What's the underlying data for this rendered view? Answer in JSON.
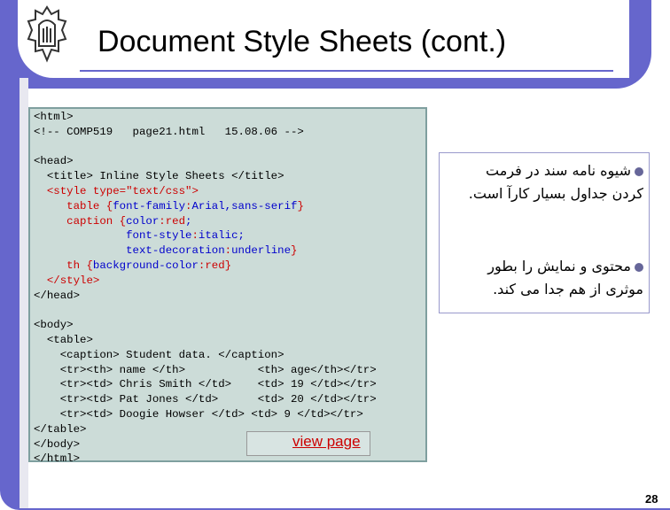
{
  "slide": {
    "title": "Document Style Sheets (cont.)",
    "page_number": "28",
    "logo_icon": "university-crest-icon",
    "colors": {
      "frame": "#6666cc",
      "code_bg": "#ccdcd8",
      "css_value": "#cc0000",
      "css_property": "#0000cc"
    }
  },
  "code": {
    "l01": "<html>",
    "l02": "<!-- COMP519   page21.html   15.08.06 -->",
    "l04": "<head>",
    "l05": "  <title> Inline Style Sheets </title>",
    "l06": "  <style type=\"text/css\">",
    "l07a": "     table {",
    "l07b": "font-family",
    "l07c": ":",
    "l07d": "Arial,sans-serif",
    "l07e": "}",
    "l08a": "     caption {",
    "l08b": "color",
    "l08c": ":",
    "l08d": "red",
    "l08e": ";",
    "l09a": "              ",
    "l09b": "font-style",
    "l09c": ":",
    "l09d": "italic",
    "l09e": ";",
    "l10a": "              ",
    "l10b": "text-decoration",
    "l10c": ":",
    "l10d": "underline",
    "l10e": "}",
    "l11a": "     th {",
    "l11b": "background-color",
    "l11c": ":",
    "l11d": "red",
    "l11e": "}",
    "l12": "  </style>",
    "l13": "</head>",
    "l15": "<body>",
    "l16": "  <table>",
    "l17": "    <caption> Student data. </caption>",
    "l18": "    <tr><th> name </th>           <th> age</th></tr>",
    "l19": "    <tr><td> Chris Smith </td>    <td> 19 </td></tr>",
    "l20": "    <tr><td> Pat Jones </td>      <td> 20 </td></tr>",
    "l21": "    <tr><td> Doogie Howser </td> <td> 9 </td></tr>",
    "l22": "</table>",
    "l23": "</body>",
    "l24": "</html>"
  },
  "link": {
    "view_page": "view page"
  },
  "notes": {
    "bullet1": "شیوه نامه سند در فرمت کردن جداول بسیار کارآ است.",
    "bullet2": "محتوی و نمایش را بطور موثری از هم جدا می کند."
  }
}
